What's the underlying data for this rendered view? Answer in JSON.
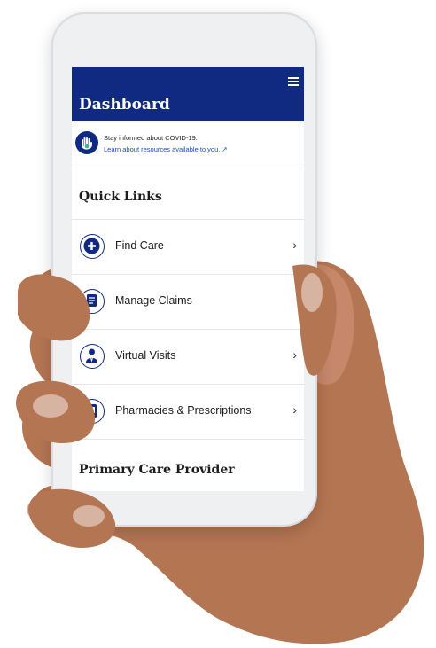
{
  "header": {
    "title": "Dashboard",
    "menu_icon": "hamburger-menu-icon"
  },
  "covid_banner": {
    "line1": "Stay informed about COVID-19.",
    "line2": "Learn about resources available to you. ↗",
    "icon": "hand-icon"
  },
  "quick_links": {
    "title": "Quick Links",
    "items": [
      {
        "label": "Find Care",
        "icon": "plus-icon",
        "chevron": "›"
      },
      {
        "label": "Manage Claims",
        "icon": "document-icon",
        "chevron": ""
      },
      {
        "label": "Virtual Visits",
        "icon": "doctor-icon",
        "chevron": "›"
      },
      {
        "label": "Pharmacies & Prescriptions",
        "icon": "prescription-icon",
        "chevron": "›"
      }
    ]
  },
  "pcp": {
    "title": "Primary Care Provider"
  },
  "colors": {
    "brand": "#0f2a80",
    "link": "#1c4fb8"
  }
}
